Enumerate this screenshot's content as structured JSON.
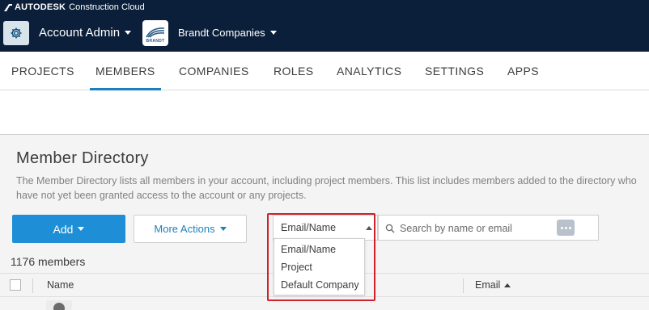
{
  "header": {
    "brand_name": "AUTODESK",
    "brand_product": "Construction Cloud",
    "settings_icon": "gear-icon",
    "admin_menu_label": "Account Admin",
    "company_logo_text": "BRANDT",
    "company_menu_label": "Brandt Companies"
  },
  "tabs": [
    {
      "label": "PROJECTS"
    },
    {
      "label": "MEMBERS",
      "active": true
    },
    {
      "label": "COMPANIES"
    },
    {
      "label": "ROLES"
    },
    {
      "label": "ANALYTICS"
    },
    {
      "label": "SETTINGS"
    },
    {
      "label": "APPS"
    }
  ],
  "directory": {
    "title": "Member Directory",
    "description": "The Member Directory lists all members in your account, including project members. This list includes members added to the directory who have not yet been granted access to the account or any projects."
  },
  "toolbar": {
    "add_label": "Add",
    "more_actions_label": "More Actions",
    "search_field_selected": "Email/Name",
    "search_placeholder": "Search by name or email"
  },
  "search_field_options": [
    "Email/Name",
    "Project",
    "Default Company"
  ],
  "member_count": "1176 members",
  "table": {
    "columns": {
      "name": "Name",
      "email": "Email"
    },
    "sort_column": "Email",
    "sort_direction": "ascending"
  },
  "colors": {
    "topbar": "#0b1f3a",
    "accent": "#1e8fd6",
    "highlight": "#d0212a"
  }
}
